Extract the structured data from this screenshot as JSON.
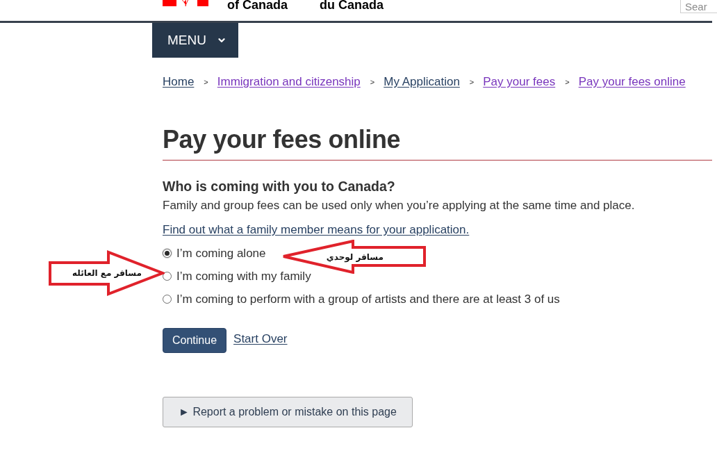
{
  "header": {
    "wordmark": [
      "of Canada",
      "du Canada"
    ],
    "search": {
      "placeholder": "Sear"
    }
  },
  "menu": {
    "label": "MENU"
  },
  "breadcrumb": [
    {
      "label": "Home",
      "visited": false
    },
    {
      "separator": ">",
      "label": "Immigration and citizenship",
      "visited": true
    },
    {
      "separator": ">",
      "label": "My Application",
      "visited": false
    },
    {
      "separator": ">",
      "label": "Pay your fees",
      "visited": true
    },
    {
      "separator": ">",
      "label": "Pay your fees online",
      "visited": true
    }
  ],
  "title": "Pay your fees online",
  "question": {
    "heading": "Who is coming with you to Canada?",
    "description": "Family and group fees can be used only when you’re applying at the same time and place.",
    "help_link": "Find out what a family member means for your application.",
    "options": [
      {
        "label": "I’m coming alone",
        "selected": true,
        "annotation": {
          "text": "مسافر لوحدي",
          "kind": "leftward"
        }
      },
      {
        "label": "I’m coming with my family",
        "selected": false,
        "annotation": {
          "text": "مسافر مع العائله",
          "kind": "rightward"
        }
      },
      {
        "label": "I’m coming to perform with a group of artists and there are at least 3 of us",
        "selected": false
      }
    ]
  },
  "actions": [
    {
      "kind": "primary",
      "label": "Continue"
    },
    {
      "kind": "link",
      "label": "Start Over"
    }
  ],
  "report_button": {
    "label": "► Report a problem or mistake on this page"
  }
}
